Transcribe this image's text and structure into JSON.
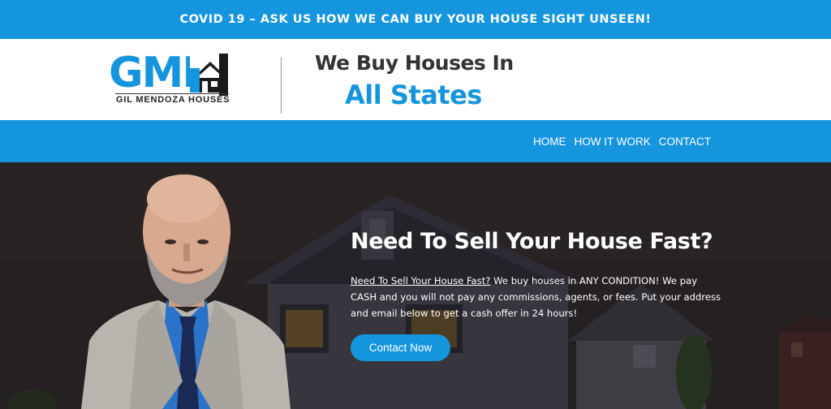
{
  "announcement": "COVID 19 – ASK US HOW WE CAN BUY YOUR HOUSE SIGHT UNSEEN!",
  "logo": {
    "letters": "GMH",
    "subtitle": "GIL MENDOZA HOUSES"
  },
  "tagline": {
    "line1": "We Buy Houses In",
    "line2": "All States"
  },
  "nav": {
    "items": [
      "HOME",
      "HOW IT WORK",
      "CONTACT"
    ]
  },
  "hero": {
    "title": "Need To Sell Your House Fast?",
    "lead": "Need To Sell Your House Fast?",
    "body": " We buy houses in ANY CONDITION! We pay CASH and you will not pay any commissions, agents, or fees. Put your address and email below to get a cash offer in 24 hours!",
    "cta": "Contact Now"
  },
  "colors": {
    "brand_blue": "#1595dd",
    "dark_text": "#333333",
    "hero_bg": "#2b2727"
  }
}
